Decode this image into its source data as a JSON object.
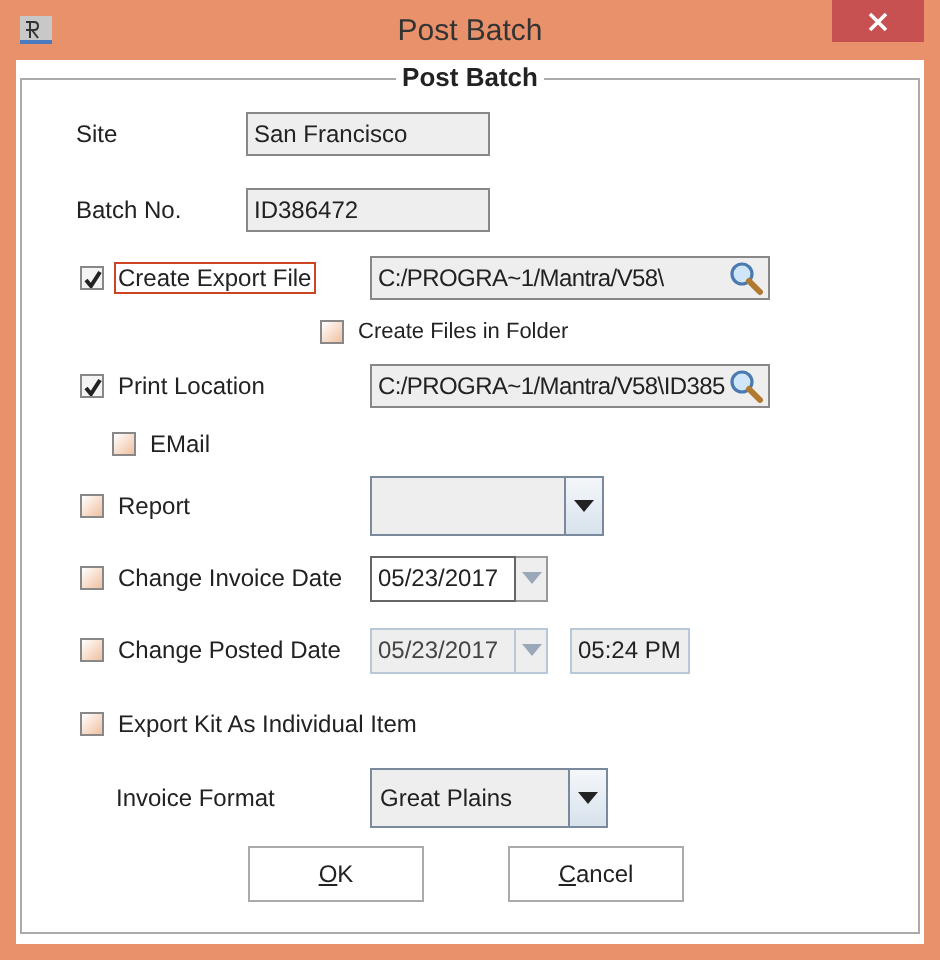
{
  "window": {
    "title": "Post Batch"
  },
  "group_title": "Post Batch",
  "fields": [
    {
      "kind": "text",
      "label": "Site",
      "value": "San Francisco"
    },
    {
      "kind": "text",
      "label": "Batch No.",
      "value": "ID386472"
    },
    {
      "kind": "checkbox_path",
      "label": "Create Export File",
      "checked": true,
      "focused": true,
      "value": "C:/PROGRA~1/Mantra/V58\\"
    },
    {
      "kind": "subcheck",
      "label": "Create Files in Folder",
      "checked": false
    },
    {
      "kind": "checkbox_path",
      "label": "Print Location",
      "checked": true,
      "focused": false,
      "value": "C:/PROGRA~1/Mantra/V58\\ID385"
    },
    {
      "kind": "indent_check",
      "label": "EMail",
      "checked": false
    },
    {
      "kind": "checkbox_combo",
      "label": "Report",
      "checked": false
    },
    {
      "kind": "checkbox_date",
      "label": "Change Invoice Date",
      "checked": false,
      "date": "05/23/2017",
      "disabled": false
    },
    {
      "kind": "checkbox_date",
      "label": "Change Posted Date",
      "checked": false,
      "date": "05/23/2017",
      "disabled": true,
      "time": "05:24 PM"
    },
    {
      "kind": "checkbox",
      "label": "Export Kit As Individual Item",
      "checked": false
    },
    {
      "kind": "combo",
      "label": "Invoice Format",
      "value": "Great Plains"
    }
  ],
  "buttons": [
    "OK",
    "Cancel"
  ]
}
